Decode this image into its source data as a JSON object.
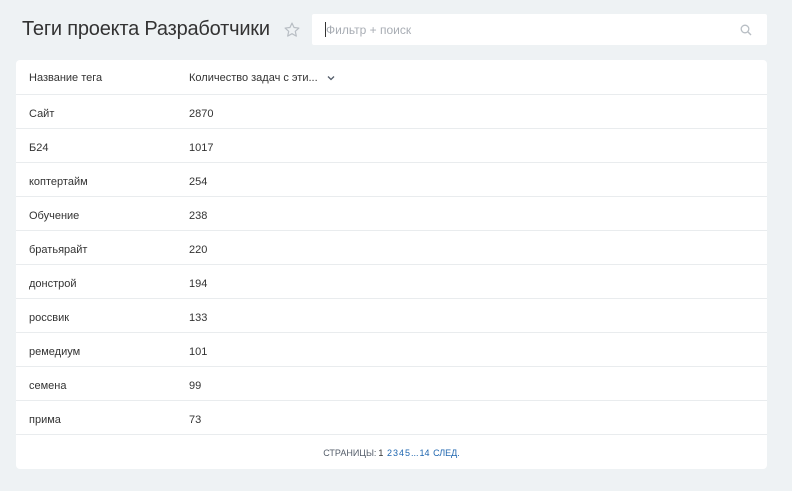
{
  "header": {
    "title": "Теги проекта Разработчики",
    "star_icon": "star-outline-icon",
    "search": {
      "value": "",
      "placeholder": "Фильтр + поиск",
      "icon": "search-icon"
    }
  },
  "table": {
    "columns": {
      "name": "Название тега",
      "count": "Количество задач с эти...",
      "count_sort_icon": "chevron-down-icon"
    },
    "rows": [
      {
        "name": "Сайт",
        "count": "2870"
      },
      {
        "name": "Б24",
        "count": "1017"
      },
      {
        "name": "коптертайм",
        "count": "254"
      },
      {
        "name": "Обучение",
        "count": "238"
      },
      {
        "name": "братьярайт",
        "count": "220"
      },
      {
        "name": "донстрой",
        "count": "194"
      },
      {
        "name": "россвик",
        "count": "133"
      },
      {
        "name": "ремедиум",
        "count": "101"
      },
      {
        "name": "семена",
        "count": "99"
      },
      {
        "name": "прима",
        "count": "73"
      }
    ]
  },
  "pagination": {
    "label": "СТРАНИЦЫ:",
    "current": "1",
    "pages": [
      "2",
      "3",
      "4",
      "5"
    ],
    "ellipsis": "...",
    "last": "14",
    "next": "СЛЕД."
  },
  "colors": {
    "background": "#eef2f4",
    "link": "#2067b0",
    "text": "#333333",
    "placeholder": "#a8adb4"
  }
}
